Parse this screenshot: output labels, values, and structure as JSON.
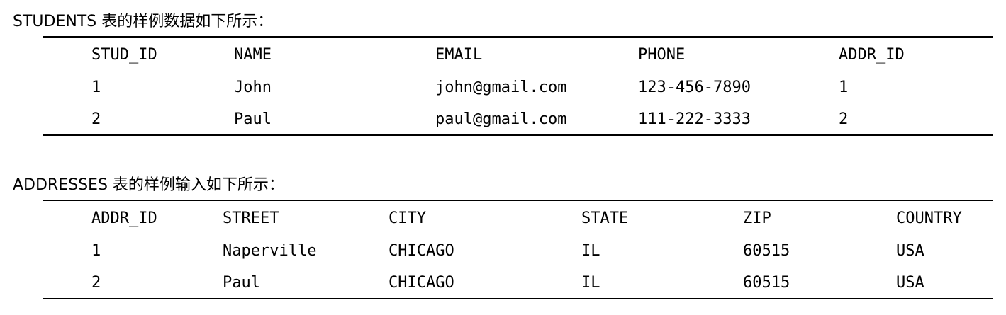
{
  "students_caption": "STUDENTS 表的样例数据如下所示：",
  "students_table": {
    "headers": [
      "STUD_ID",
      "NAME",
      "EMAIL",
      "PHONE",
      "ADDR_ID"
    ],
    "rows": [
      [
        "1",
        "John",
        "john@gmail.com",
        "123-456-7890",
        "1"
      ],
      [
        "2",
        "Paul",
        "paul@gmail.com",
        "111-222-3333",
        "2"
      ]
    ]
  },
  "addresses_caption": "ADDRESSES 表的样例输入如下所示：",
  "addresses_table": {
    "headers": [
      "ADDR_ID",
      "STREET",
      "CITY",
      "STATE",
      "ZIP",
      "COUNTRY"
    ],
    "rows": [
      [
        "1",
        "Naperville",
        "CHICAGO",
        "IL",
        "60515",
        "USA"
      ],
      [
        "2",
        "Paul",
        "CHICAGO",
        "IL",
        "60515",
        "USA"
      ]
    ]
  }
}
